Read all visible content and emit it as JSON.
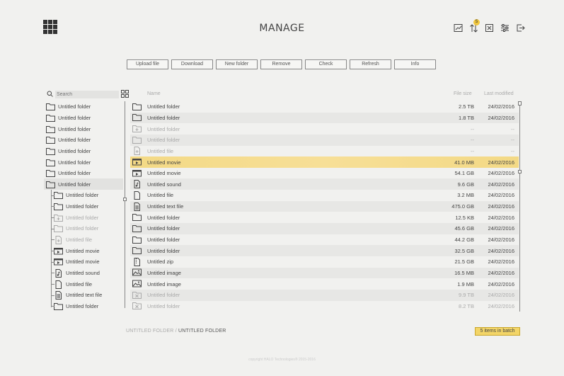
{
  "header": {
    "title": "MANAGE",
    "icons": [
      "chart-icon",
      "sort-icon",
      "close-box-icon",
      "sliders-icon",
      "logout-icon"
    ],
    "sort_badge": "5"
  },
  "toolbar": {
    "buttons": [
      "Upload file",
      "Download",
      "New folder",
      "Remove",
      "Check",
      "Refresh",
      "Info"
    ]
  },
  "search": {
    "placeholder": "Search"
  },
  "columns": {
    "name": "Name",
    "size": "File size",
    "modified": "Last modified"
  },
  "tree": [
    {
      "label": "Untitled folder",
      "icon": "folder-icon",
      "child": false,
      "faded": false,
      "selected": false
    },
    {
      "label": "Untitled folder",
      "icon": "folder-icon",
      "child": false,
      "faded": false,
      "selected": false
    },
    {
      "label": "Untitled folder",
      "icon": "folder-icon",
      "child": false,
      "faded": false,
      "selected": false
    },
    {
      "label": "Untitled folder",
      "icon": "folder-icon",
      "child": false,
      "faded": false,
      "selected": false
    },
    {
      "label": "Untitled folder",
      "icon": "folder-icon",
      "child": false,
      "faded": false,
      "selected": false
    },
    {
      "label": "Untitled folder",
      "icon": "folder-icon",
      "child": false,
      "faded": false,
      "selected": false
    },
    {
      "label": "Untitled folder",
      "icon": "folder-icon",
      "child": false,
      "faded": false,
      "selected": false
    },
    {
      "label": "Untitled folder",
      "icon": "folder-icon",
      "child": false,
      "faded": false,
      "selected": true
    },
    {
      "label": "Untitled folder",
      "icon": "folder-icon",
      "child": true,
      "faded": false,
      "selected": false
    },
    {
      "label": "Untitled folder",
      "icon": "folder-icon",
      "child": true,
      "faded": false,
      "selected": false
    },
    {
      "label": "Untitled folder",
      "icon": "folder-add-icon",
      "child": true,
      "faded": true,
      "selected": false
    },
    {
      "label": "Untitled folder",
      "icon": "folder-icon",
      "child": true,
      "faded": true,
      "selected": false
    },
    {
      "label": "Untitled file",
      "icon": "file-add-icon",
      "child": true,
      "faded": true,
      "selected": false
    },
    {
      "label": "Untitled movie",
      "icon": "movie-icon",
      "child": true,
      "faded": false,
      "selected": false
    },
    {
      "label": "Untitled movie",
      "icon": "movie-icon",
      "child": true,
      "faded": false,
      "selected": false
    },
    {
      "label": "Untitled sound",
      "icon": "sound-icon",
      "child": true,
      "faded": false,
      "selected": false
    },
    {
      "label": "Untitled file",
      "icon": "file-icon",
      "child": true,
      "faded": false,
      "selected": false
    },
    {
      "label": "Untitled text file",
      "icon": "text-file-icon",
      "child": true,
      "faded": false,
      "selected": false
    },
    {
      "label": "Untitled folder",
      "icon": "folder-icon",
      "child": true,
      "faded": false,
      "selected": false
    }
  ],
  "files": [
    {
      "name": "Untitled folder",
      "icon": "folder-icon",
      "size": "2.5 TB",
      "date": "24/02/2016",
      "faded": false,
      "selected": false
    },
    {
      "name": "Untitled folder",
      "icon": "folder-icon",
      "size": "1.8 TB",
      "date": "24/02/2016",
      "faded": false,
      "selected": false
    },
    {
      "name": "Untitled folder",
      "icon": "folder-add-icon",
      "size": "--",
      "date": "--",
      "faded": true,
      "selected": false
    },
    {
      "name": "Untitled folder",
      "icon": "folder-icon",
      "size": "--",
      "date": "--",
      "faded": true,
      "selected": false
    },
    {
      "name": "Untitled file",
      "icon": "file-add-icon",
      "size": "--",
      "date": "--",
      "faded": true,
      "selected": false
    },
    {
      "name": "Untitled movie",
      "icon": "movie-icon",
      "size": "41.0 MB",
      "date": "24/02/2016",
      "faded": false,
      "selected": true
    },
    {
      "name": "Untitled movie",
      "icon": "movie-icon",
      "size": "54.1 GB",
      "date": "24/02/2016",
      "faded": false,
      "selected": false
    },
    {
      "name": "Untitled sound",
      "icon": "sound-icon",
      "size": "9.6 GB",
      "date": "24/02/2016",
      "faded": false,
      "selected": false
    },
    {
      "name": "Untitled file",
      "icon": "file-icon",
      "size": "3.2 MB",
      "date": "24/02/2016",
      "faded": false,
      "selected": false
    },
    {
      "name": "Untitled text file",
      "icon": "text-file-icon",
      "size": "475.0 GB",
      "date": "24/02/2016",
      "faded": false,
      "selected": false
    },
    {
      "name": "Untitled folder",
      "icon": "folder-icon",
      "size": "12.5 KB",
      "date": "24/02/2016",
      "faded": false,
      "selected": false
    },
    {
      "name": "Untitled folder",
      "icon": "folder-icon",
      "size": "45.6 GB",
      "date": "24/02/2016",
      "faded": false,
      "selected": false
    },
    {
      "name": "Untitled folder",
      "icon": "folder-icon",
      "size": "44.2 GB",
      "date": "24/02/2016",
      "faded": false,
      "selected": false
    },
    {
      "name": "Untitled folder",
      "icon": "folder-icon",
      "size": "32.5 GB",
      "date": "24/02/2016",
      "faded": false,
      "selected": false
    },
    {
      "name": "Untitled zip",
      "icon": "zip-icon",
      "size": "21.5 GB",
      "date": "24/02/2016",
      "faded": false,
      "selected": false
    },
    {
      "name": "Untitled image",
      "icon": "image-icon",
      "size": "16.5 MB",
      "date": "24/02/2016",
      "faded": false,
      "selected": false
    },
    {
      "name": "Untitled image",
      "icon": "image-icon",
      "size": "1.9 MB",
      "date": "24/02/2016",
      "faded": false,
      "selected": false
    },
    {
      "name": "Untitled folder",
      "icon": "folder-remove-icon",
      "size": "9.9 TB",
      "date": "24/02/2016",
      "faded": true,
      "selected": false
    },
    {
      "name": "Untitled folder",
      "icon": "folder-remove-icon",
      "size": "8.2 TB",
      "date": "24/02/2016",
      "faded": true,
      "selected": false
    }
  ],
  "footer": {
    "breadcrumb_parent": "UNTITLED FOLDER",
    "breadcrumb_sep": " / ",
    "breadcrumb_current": "UNTITLED FOLDER",
    "batch": "5 items in batch",
    "copyright": "copyright HALO Technologies® 2015-2016"
  },
  "colors": {
    "accent": "#f3d567",
    "selected_row": "#f5dc8e"
  }
}
